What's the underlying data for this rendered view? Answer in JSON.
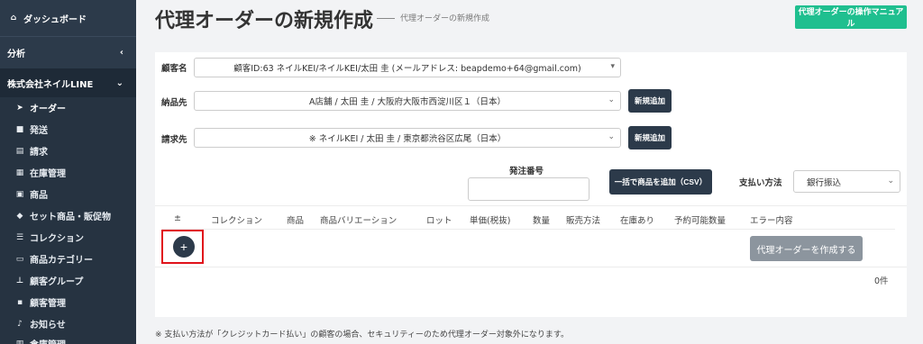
{
  "sidebar": {
    "dashboard": {
      "icon": "home-icon",
      "label": "ダッシュボード"
    },
    "analysis": {
      "label": "分析",
      "chevron": "‹"
    },
    "company": {
      "label": "株式会社ネイルLINE",
      "chevron": "⌄"
    },
    "items": [
      {
        "icon": "send-icon",
        "label": "オーダー",
        "active": true
      },
      {
        "icon": "truck-icon",
        "label": "発送"
      },
      {
        "icon": "document-icon",
        "label": "請求"
      },
      {
        "icon": "warehouse-icon",
        "label": "在庫管理"
      },
      {
        "icon": "bag-icon",
        "label": "商品"
      },
      {
        "icon": "tag-icon",
        "label": "セット商品・販促物"
      },
      {
        "icon": "list-icon",
        "label": "コレクション"
      },
      {
        "icon": "category-icon",
        "label": "商品カテゴリー"
      },
      {
        "icon": "group-icon",
        "label": "顧客グループ"
      },
      {
        "icon": "customer-icon",
        "label": "顧客管理"
      },
      {
        "icon": "bell-icon",
        "label": "お知らせ"
      },
      {
        "icon": "building-icon",
        "label": "倉庫管理"
      }
    ]
  },
  "header": {
    "title": "代理オーダーの新規作成",
    "subtitle": "代理オーダーの新規作成",
    "manual_button": "代理オーダーの操作マニュアル"
  },
  "form": {
    "customer_label": "顧客名",
    "customer_value": "顧客ID:63 ネイルKEI/ネイルKEI/太田 圭 (メールアドレス: beapdemo+64@gmail.com)",
    "delivery_label": "納品先",
    "delivery_value": "A店舗 / 太田 圭 / 大阪府大阪市西淀川区１（日本）",
    "billing_label": "請求先",
    "billing_value": "※ ネイルKEI / 太田 圭 / 東京都渋谷区広尾（日本）",
    "new_add_button": "新規追加",
    "order_number_label": "発注番号",
    "order_number_value": "",
    "csv_button": "一括で商品を追加（CSV）",
    "payment_label": "支払い方法",
    "payment_value": "銀行振込"
  },
  "table": {
    "headers": [
      "±",
      "コレクション",
      "商品",
      "商品バリエーション",
      "ロット",
      "単価(税抜)",
      "数量",
      "販売方法",
      "在庫あり",
      "予約可能数量",
      "エラー内容"
    ],
    "add_symbol": "+",
    "create_button": "代理オーダーを作成する",
    "count": "0件"
  },
  "footer_note": "※ 支払い方法が「クレジットカード払い」の顧客の場合、セキュリティーのため代理オーダー対象外になります。",
  "colors": {
    "sidebar_bg": "#2c3a4a",
    "manual_button": "#1fbf8f",
    "highlight": "#e0121b",
    "create_button": "#8c959e"
  }
}
